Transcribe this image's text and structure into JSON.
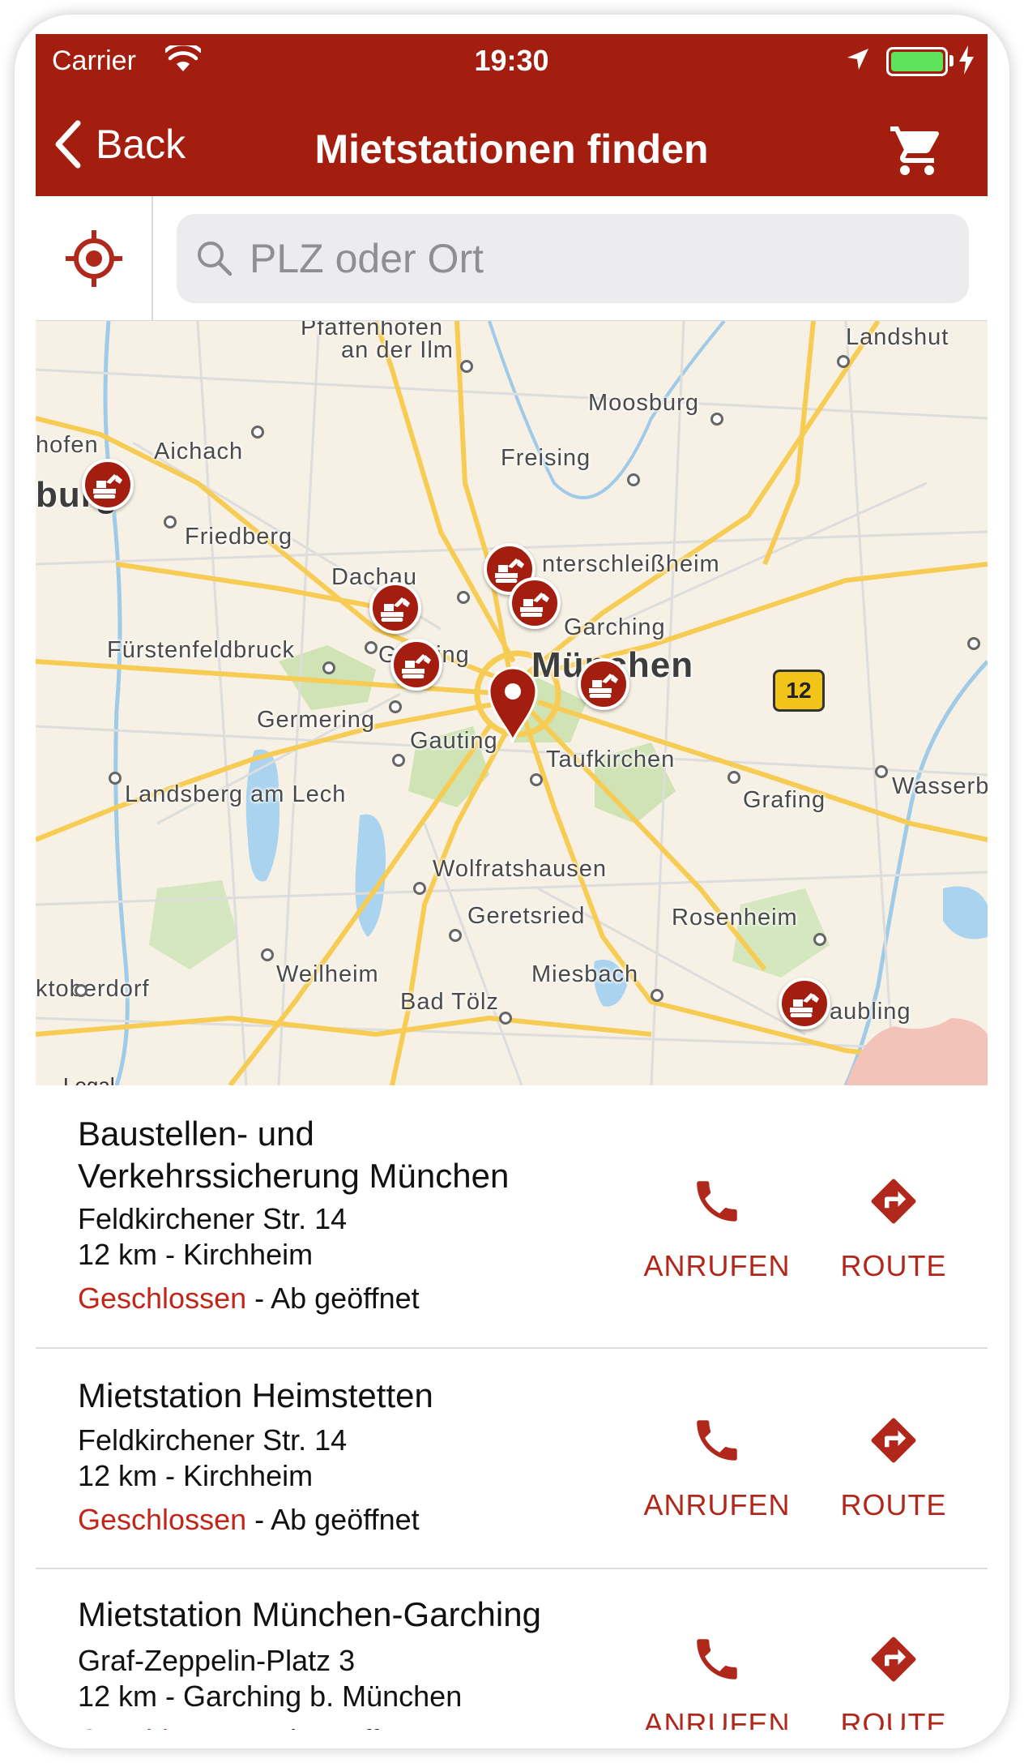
{
  "status_bar": {
    "carrier": "Carrier",
    "time": "19:30"
  },
  "nav": {
    "back_label": "Back",
    "title": "Mietstationen finden"
  },
  "search": {
    "placeholder": "PLZ oder Ort",
    "value": ""
  },
  "map": {
    "labels": {
      "pfaffenhofen": "Pfaffenhofen",
      "an_der_ilm": "an der Ilm",
      "landshut": "Landshut",
      "moosburg": "Moosburg",
      "hofen": "hofen",
      "aichach": "Aichach",
      "freising": "Freising",
      "burg": "burg",
      "friedberg": "Friedberg",
      "dachau": "Dachau",
      "unterschleissheim": "nterschleißheim",
      "garching": "Garching",
      "fuerstenfeldbruck": "Fürstenfeldbruck",
      "gilching": "Gilching",
      "muenchen": "München",
      "germering": "Germering",
      "gauting": "Gauting",
      "taufkirchen": "Taufkirchen",
      "landsberg": "Landsberg am Lech",
      "grafing": "Grafing",
      "wasserburg": "Wasserb",
      "wolfratshausen": "Wolfratshausen",
      "geretsried": "Geretsried",
      "rosenheim": "Rosenheim",
      "weilheim": "Weilheim",
      "miesbach": "Miesbach",
      "marktoberdorf": "ktoberdorf",
      "bad_toelz": "Bad Tölz",
      "raubling": "aubling"
    },
    "road_shield": "12",
    "legal": "Legal",
    "pins": [
      "rental-station"
    ]
  },
  "stations": [
    {
      "name": "Baustellen- und Verkehrssicherung München",
      "street": "Feldkirchener Str. 14",
      "distance": "12 km - Kirchheim",
      "status_closed": "Geschlossen",
      "status_rest": " - Ab  geöffnet",
      "call_label": "ANRUFEN",
      "route_label": "ROUTE"
    },
    {
      "name": "Mietstation Heimstetten",
      "street": "Feldkirchener Str. 14",
      "distance": "12 km - Kirchheim",
      "status_closed": "Geschlossen",
      "status_rest": " - Ab  geöffnet",
      "call_label": "ANRUFEN",
      "route_label": "ROUTE"
    },
    {
      "name": "Mietstation München-Garching",
      "street": "Graf-Zeppelin-Platz 3",
      "distance": "12 km - Garching b. München",
      "status_closed": "Geschlossen",
      "status_rest": " - Ab  geöffnet",
      "call_label": "ANRUFEN",
      "route_label": "ROUTE"
    }
  ],
  "colors": {
    "brand_red": "#a41e0f",
    "closed_red": "#c0271b",
    "battery_green": "#5fe35b"
  }
}
